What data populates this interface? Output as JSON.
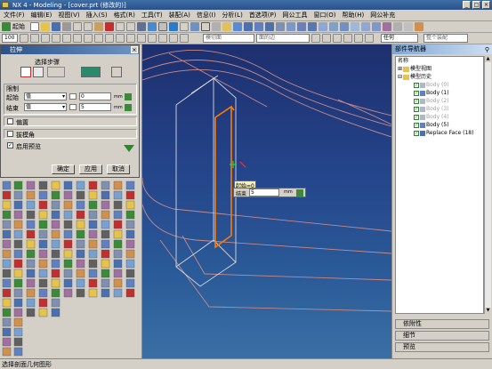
{
  "window": {
    "title": "NX 4 - Modeling - [cover.prt (修改的)]"
  },
  "menu": [
    "文件(F)",
    "编辑(E)",
    "视图(V)",
    "插入(S)",
    "格式(R)",
    "工具(T)",
    "装配(A)",
    "信息(I)",
    "分析(L)",
    "首选项(P)",
    "网公工具",
    "窗口(O)",
    "帮助(H)",
    "网公补充"
  ],
  "toolbar": {
    "start_label": "起始",
    "zoom_value": "100",
    "filter_combo": "模切面",
    "face_combo": "面的边",
    "scope_combo": "任何",
    "assembly_combo": "整个装配"
  },
  "dialog": {
    "title": "拉伸",
    "select_steps_label": "选择步骤",
    "limits_label": "限制",
    "start_label": "起始",
    "start_type": "值",
    "start_value": "0",
    "start_unit": "mm",
    "end_label": "结束",
    "end_type": "值",
    "end_value": "5",
    "end_unit": "mm",
    "offset_label": "偏置",
    "draft_label": "拔模角",
    "preview_label": "启用预览",
    "preview_checked": "✓",
    "ok_label": "确定",
    "apply_label": "应用",
    "cancel_label": "取消"
  },
  "viewport": {
    "start_tag": "起始=0",
    "end_label": "结束",
    "end_value": "5",
    "end_unit": "mm"
  },
  "navigator": {
    "title": "部件导航器",
    "column_name": "名称",
    "items": [
      {
        "label": "模型视图",
        "state": "folder"
      },
      {
        "label": "模型历史",
        "state": "folder"
      },
      {
        "label": "Body (0)",
        "state": "dim"
      },
      {
        "label": "Body (1)",
        "state": "active"
      },
      {
        "label": "Body (2)",
        "state": "dim"
      },
      {
        "label": "Body (3)",
        "state": "dim"
      },
      {
        "label": "Body (4)",
        "state": "dim"
      },
      {
        "label": "Body (5)",
        "state": "active"
      },
      {
        "label": "Replace Face (18)",
        "state": "active"
      }
    ],
    "panels": [
      "依附性",
      "细节",
      "预览"
    ]
  },
  "status": {
    "text": "选择剖面几何图形"
  },
  "colors": {
    "viewport_top": "#1d2f6e",
    "viewport_bottom": "#3b6fa4",
    "wire": "#c88a8a",
    "highlight": "#ff7a00",
    "title_blue": "#2a5288"
  }
}
